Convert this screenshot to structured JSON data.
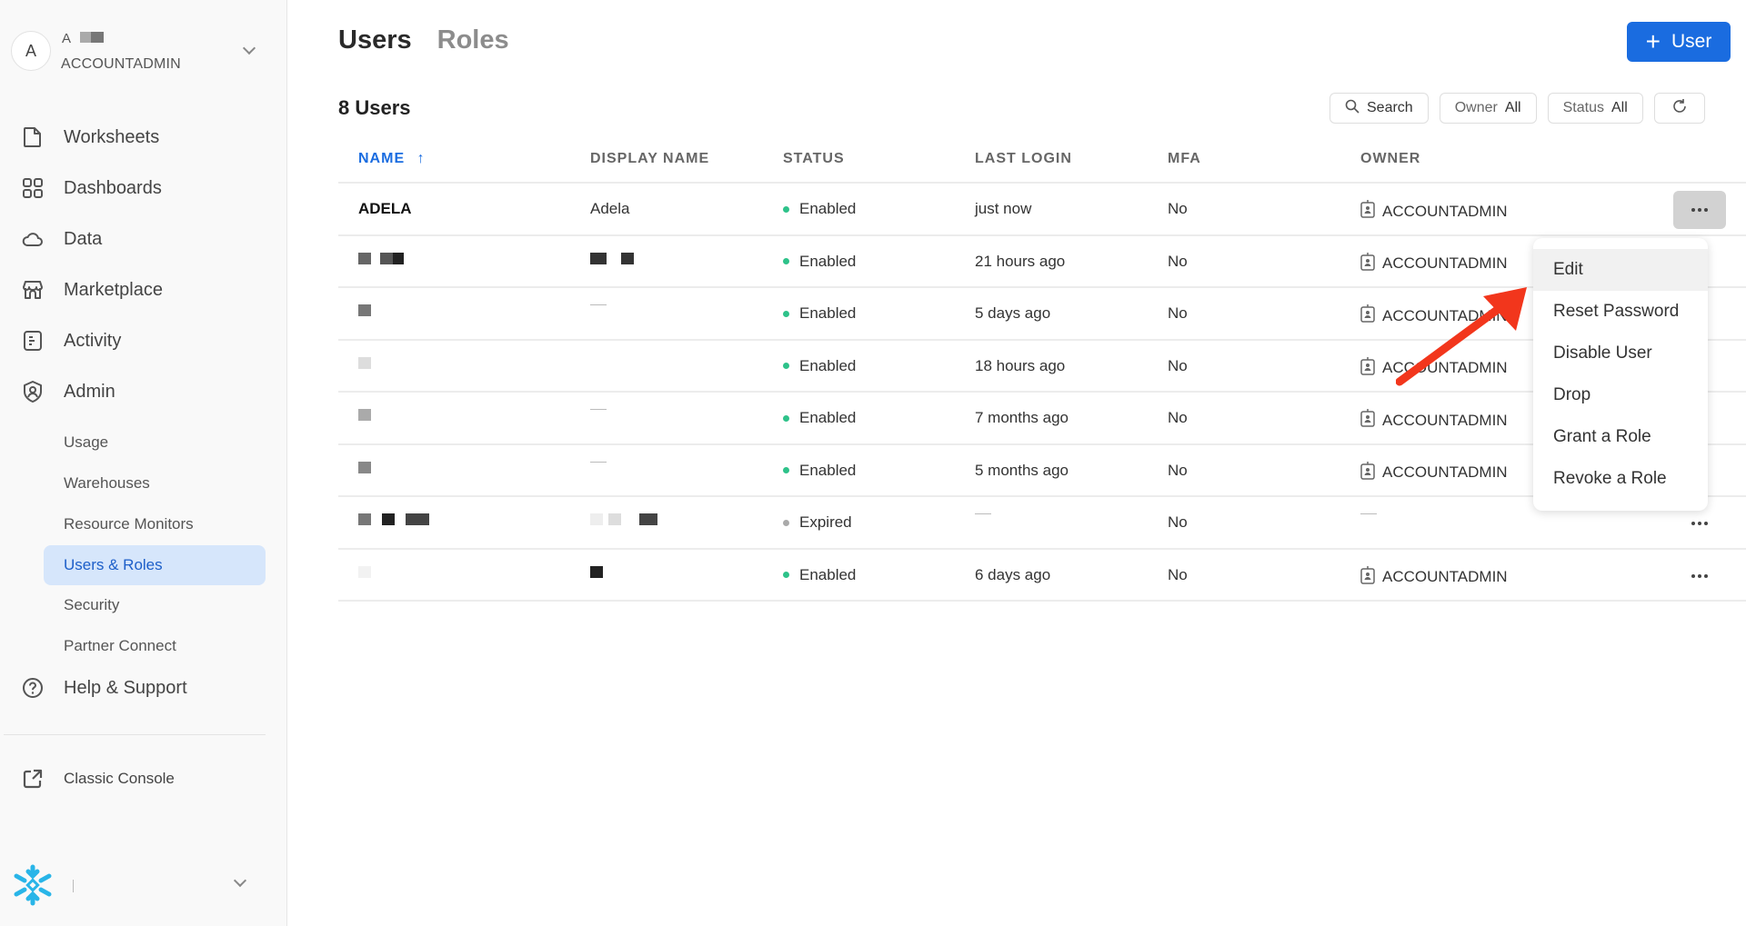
{
  "sidebar": {
    "account": {
      "avatar_letter": "A",
      "name_prefix": "A",
      "role": "ACCOUNTADMIN"
    },
    "nav": [
      {
        "label": "Worksheets",
        "icon": "document-icon"
      },
      {
        "label": "Dashboards",
        "icon": "grid-icon"
      },
      {
        "label": "Data",
        "icon": "cloud-icon"
      },
      {
        "label": "Marketplace",
        "icon": "store-icon"
      },
      {
        "label": "Activity",
        "icon": "activity-icon"
      },
      {
        "label": "Admin",
        "icon": "shield-user-icon"
      }
    ],
    "admin_sub": [
      {
        "label": "Usage",
        "active": false
      },
      {
        "label": "Warehouses",
        "active": false
      },
      {
        "label": "Resource Monitors",
        "active": false
      },
      {
        "label": "Users & Roles",
        "active": true
      },
      {
        "label": "Security",
        "active": false
      },
      {
        "label": "Partner Connect",
        "active": false
      }
    ],
    "help": {
      "label": "Help & Support",
      "icon": "help-icon"
    },
    "classic_console": {
      "label": "Classic Console",
      "icon": "external-link-icon"
    }
  },
  "main": {
    "tabs": [
      {
        "label": "Users",
        "active": true
      },
      {
        "label": "Roles",
        "active": false
      }
    ],
    "add_button": {
      "label": "User",
      "icon": "plus-icon"
    },
    "count_label": "8 Users",
    "toolbar": {
      "search_label": "Search",
      "owner_filter": {
        "label": "Owner",
        "value": "All"
      },
      "status_filter": {
        "label": "Status",
        "value": "All"
      }
    },
    "table": {
      "columns": [
        "NAME",
        "DISPLAY NAME",
        "STATUS",
        "LAST LOGIN",
        "MFA",
        "OWNER"
      ],
      "sort": {
        "column": "NAME",
        "direction": "ascending"
      },
      "rows": [
        {
          "name": "ADELA",
          "display_name": "Adela",
          "status": "Enabled",
          "last_login": "just now",
          "mfa": "No",
          "owner": "ACCOUNTADMIN",
          "redacted": false
        },
        {
          "name": "",
          "display_name": "",
          "status": "Enabled",
          "last_login": "21 hours ago",
          "mfa": "No",
          "owner": "ACCOUNTADMIN",
          "redacted": true
        },
        {
          "name": "",
          "display_name": "—",
          "status": "Enabled",
          "last_login": "5 days ago",
          "mfa": "No",
          "owner": "ACCOUNTADMIN",
          "redacted": true
        },
        {
          "name": "",
          "display_name": "",
          "status": "Enabled",
          "last_login": "18 hours ago",
          "mfa": "No",
          "owner": "ACCOUNTADMIN",
          "redacted": true
        },
        {
          "name": "",
          "display_name": "—",
          "status": "Enabled",
          "last_login": "7 months ago",
          "mfa": "No",
          "owner": "ACCOUNTADMIN",
          "redacted": true
        },
        {
          "name": "",
          "display_name": "—",
          "status": "Enabled",
          "last_login": "5 months ago",
          "mfa": "No",
          "owner": "ACCOUNTADMIN",
          "redacted": true
        },
        {
          "name": "",
          "display_name": "",
          "status": "Expired",
          "last_login": "—",
          "mfa": "No",
          "owner": "—",
          "redacted": true
        },
        {
          "name": "",
          "display_name": "",
          "status": "Enabled",
          "last_login": "6 days ago",
          "mfa": "No",
          "owner": "ACCOUNTADMIN",
          "redacted": true
        }
      ]
    },
    "row_menu": {
      "items": [
        "Edit",
        "Reset Password",
        "Disable User",
        "Drop",
        "Grant a Role",
        "Revoke a Role"
      ],
      "hovered": "Edit"
    }
  },
  "colors": {
    "accent": "#1a6ce0",
    "enabled": "#2ec28a",
    "expired": "#aaaaaa",
    "annotation_arrow": "#f2361c",
    "snowflake_logo": "#29b5e8"
  }
}
